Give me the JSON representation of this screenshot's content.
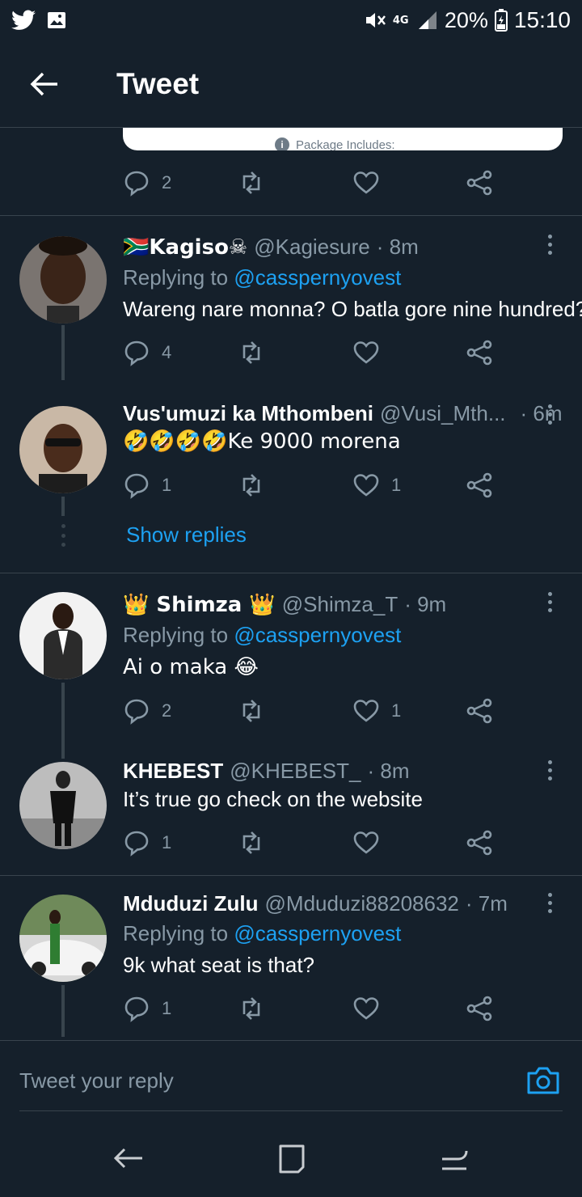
{
  "status_bar": {
    "left_icons": [
      "twitter-icon",
      "image-icon"
    ],
    "signal": "4G",
    "battery": "20%",
    "time": "15:10"
  },
  "app_bar": {
    "title": "Tweet"
  },
  "embed": {
    "text": "Package Includes:"
  },
  "top_actions": {
    "reply_count": "2",
    "retweet_count": "",
    "like_count": ""
  },
  "tweets": [
    {
      "name": "🇿🇦Kagiso☠",
      "handle": "@Kagiesure",
      "time": "· 8m",
      "replying_prefix": "Replying to ",
      "replying_to": "@casspernyovest",
      "text": "Wareng nare monna? O batla gore nine hundred?",
      "reply_count": "4",
      "like_count": ""
    },
    {
      "name": "Vus'umuzi ka Mthombeni",
      "handle": "@Vusi_Mth...",
      "time": "· 6m",
      "text": "🤣🤣🤣🤣Ke 9000 morena",
      "reply_count": "1",
      "like_count": "1"
    },
    {
      "name": "👑 Shimza 👑",
      "handle": "@Shimza_T",
      "time": "· 9m",
      "replying_prefix": "Replying to ",
      "replying_to": "@casspernyovest",
      "text": "Ai o maka 😂",
      "reply_count": "2",
      "like_count": "1"
    },
    {
      "name": "KHEBEST",
      "handle": "@KHEBEST_",
      "time": "· 8m",
      "text": "It’s true go check on the website",
      "reply_count": "1",
      "like_count": ""
    },
    {
      "name": "Mduduzi Zulu",
      "handle": "@Mduduzi88208632",
      "time": "· 7m",
      "replying_prefix": "Replying to ",
      "replying_to": "@casspernyovest",
      "text": "9k what seat is that?",
      "reply_count": "1",
      "like_count": ""
    }
  ],
  "show_replies": "Show replies",
  "composer": {
    "placeholder": "Tweet your reply"
  },
  "colors": {
    "background": "#15202b",
    "accent": "#1da1f2",
    "muted": "#8899a6",
    "divider": "#38444d"
  }
}
